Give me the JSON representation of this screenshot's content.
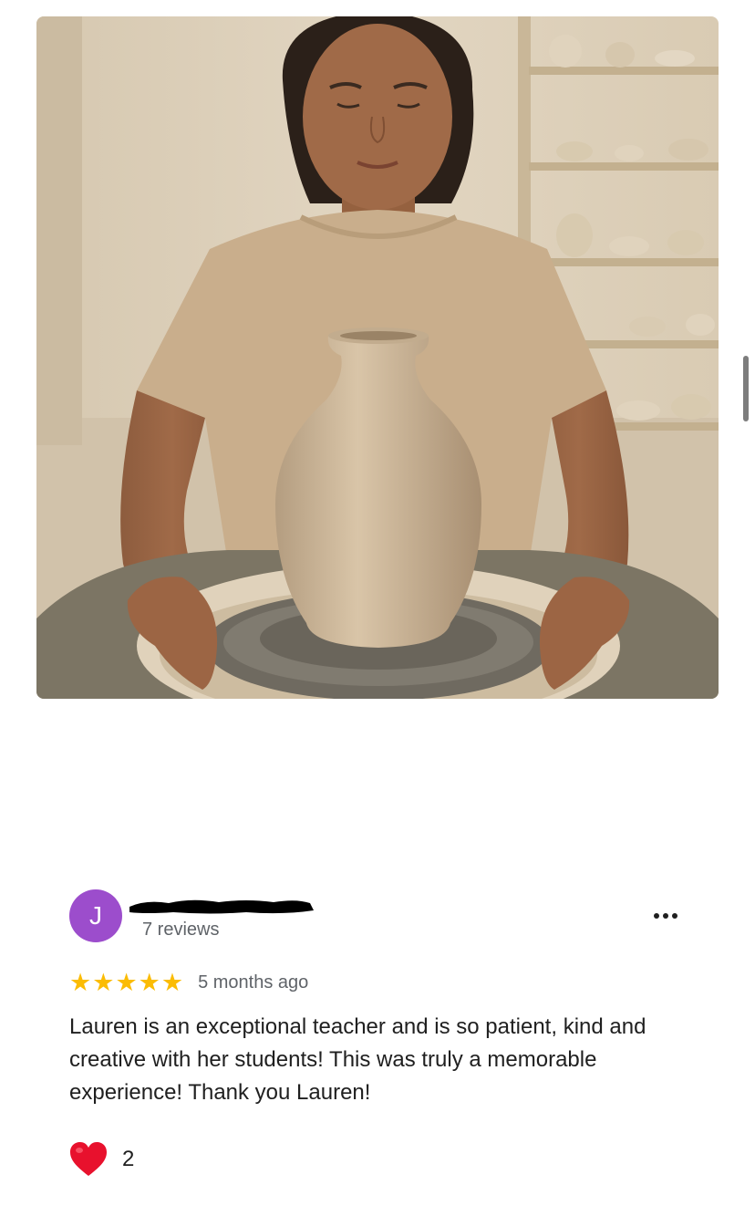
{
  "review": {
    "avatar_initial": "J",
    "avatar_color": "#9c4dcc",
    "reviewer_meta": "7 reviews",
    "rating": 5,
    "stars": [
      "★",
      "★",
      "★",
      "★",
      "★"
    ],
    "star_color": "#fbbc04",
    "time": "5 months ago",
    "text": "Lauren is an exceptional teacher and is so patient, kind and creative with her students! This was truly a memorable experience! Thank you Lauren!",
    "reaction_icon": "heart-icon",
    "reaction_count": "2",
    "menu_icon": "more-options-icon"
  }
}
